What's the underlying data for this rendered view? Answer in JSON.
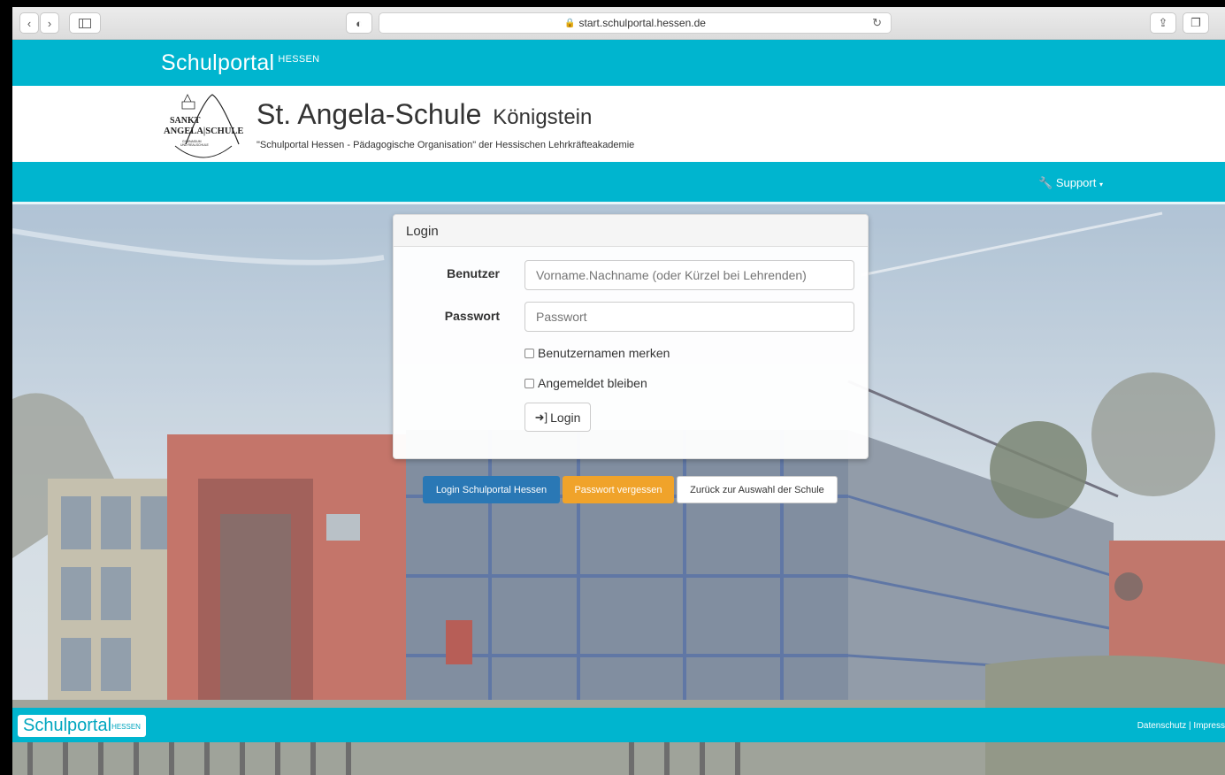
{
  "browser": {
    "url": "start.schulportal.hessen.de"
  },
  "header": {
    "brand": "Schulportal",
    "brand_sup": "HESSEN"
  },
  "school": {
    "name": "St. Angela-Schule",
    "location": "Königstein",
    "subtitle": "\"Schulportal Hessen - Pädagogische Organisation\" der Hessischen Lehrkräfteakademie",
    "logo_text_1": "SANKT",
    "logo_text_2": "ANGELA SCHULE",
    "logo_text_3": "GYMNASIUM UND REALSCHULE"
  },
  "nav": {
    "support": "Support"
  },
  "login": {
    "title": "Login",
    "user_label": "Benutzer",
    "user_placeholder": "Vorname.Nachname (oder Kürzel bei Lehrenden)",
    "password_label": "Passwort",
    "password_placeholder": "Passwort",
    "remember_user": "Benutzernamen merken",
    "stay_logged_in": "Angemeldet bleiben",
    "login_button": "Login"
  },
  "actions": {
    "portal_login": "Login Schulportal Hessen",
    "forgot_password": "Passwort vergessen",
    "back": "Zurück zur Auswahl der Schule"
  },
  "footer": {
    "brand": "Schulportal",
    "brand_sup": "HESSEN",
    "links": "Datenschutz | Impress"
  },
  "colors": {
    "teal": "#00b5cf",
    "blue_button": "#2a78b5",
    "orange_button": "#f0a32a"
  }
}
